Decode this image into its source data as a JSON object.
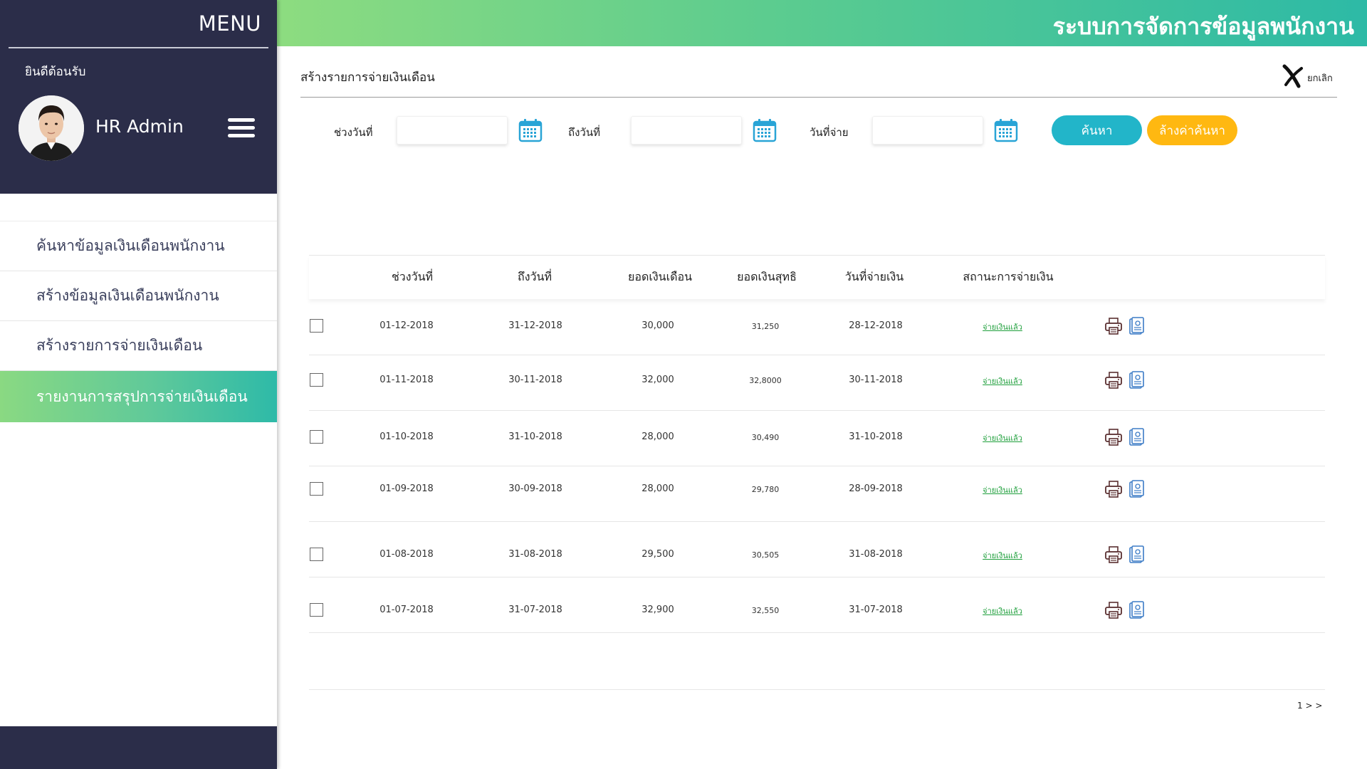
{
  "sidebar": {
    "menu_title": "MENU",
    "welcome": "ยินดีต้อนรับ",
    "user_name": "HR Admin",
    "items": [
      {
        "label": "ค้นหาข้อมูลเงินเดือนพนักงาน",
        "active": false
      },
      {
        "label": "สร้างข้อมูลเงินเดือนพนักงาน",
        "active": false
      },
      {
        "label": "สร้างรายการจ่ายเงินเดือน",
        "active": false
      },
      {
        "label": "รายงานการสรุปการจ่ายเงินเดือน",
        "active": true
      }
    ]
  },
  "header": {
    "app_title": "ระบบการจัดการข้อมูลพนักงาน"
  },
  "page": {
    "title": "สร้างรายการจ่ายเงินเดือน",
    "cancel_label": "ยกเลิก"
  },
  "filters": {
    "from_label": "ช่วงวันที่",
    "from_value": "",
    "to_label": "ถึงวันที่",
    "to_value": "",
    "pay_label": "วันที่จ่าย",
    "pay_value": "",
    "search_button": "ค้นหา",
    "clear_button": "ล้างค่าค้นหา"
  },
  "table": {
    "headers": [
      "ช่วงวันที่",
      "ถึงวันที่",
      "ยอดเงินเดือน",
      "ยอดเงินสุทธิ",
      "วันที่จ่ายเงิน",
      "สถานะการจ่ายเงิน"
    ],
    "rows": [
      {
        "from": "01-12-2018",
        "to": "31-12-2018",
        "salary": "30,000",
        "net": "31,250",
        "paid_date": "28-12-2018",
        "status": "จ่ายเงินแล้ว"
      },
      {
        "from": "01-11-2018",
        "to": "30-11-2018",
        "salary": "32,000",
        "net": "32,8000",
        "paid_date": "30-11-2018",
        "status": "จ่ายเงินแล้ว"
      },
      {
        "from": "01-10-2018",
        "to": "31-10-2018",
        "salary": "28,000",
        "net": "30,490",
        "paid_date": "31-10-2018",
        "status": "จ่ายเงินแล้ว"
      },
      {
        "from": "01-09-2018",
        "to": "30-09-2018",
        "salary": "28,000",
        "net": "29,780",
        "paid_date": "28-09-2018",
        "status": "จ่ายเงินแล้ว"
      },
      {
        "from": "01-08-2018",
        "to": "31-08-2018",
        "salary": "29,500",
        "net": "30,505",
        "paid_date": "31-08-2018",
        "status": "จ่ายเงินแล้ว"
      },
      {
        "from": "01-07-2018",
        "to": "31-07-2018",
        "salary": "32,900",
        "net": "32,550",
        "paid_date": "31-07-2018",
        "status": "จ่ายเงินแล้ว"
      }
    ],
    "pager": "1 > >"
  },
  "icons": {
    "calendar": "calendar-icon",
    "print": "printer-icon",
    "document": "document-icon",
    "cancel": "close-x-icon",
    "menu": "hamburger-menu-icon"
  },
  "colors": {
    "sidebar_dark": "#2b2d49",
    "accent_green": "#8ddc80",
    "accent_teal": "#2dbaa6",
    "search_button": "#22b5c9",
    "clear_button": "#ffb811",
    "status_paid": "#1e9f3b",
    "calendar_icon": "#29a4d6"
  }
}
